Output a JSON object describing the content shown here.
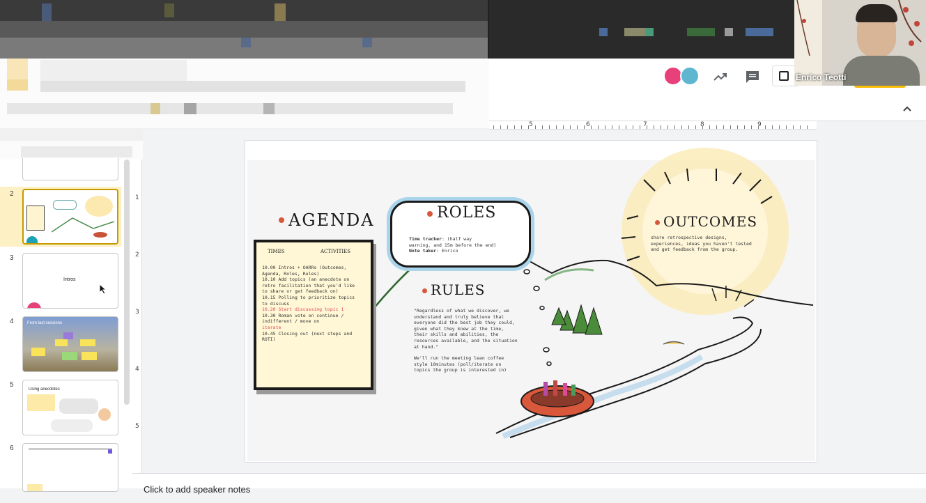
{
  "app": {
    "participant_name": "Enrico Teotti"
  },
  "toolbar": {
    "collapse_icon": "chevron-up-icon",
    "trend_icon": "trending-up-icon",
    "comment_icon": "comment-icon",
    "present_icon": "present-icon"
  },
  "ruler": {
    "labels": [
      "5",
      "6",
      "7",
      "8",
      "9"
    ]
  },
  "vruler": {
    "labels": [
      "1",
      "2",
      "3",
      "4",
      "5"
    ]
  },
  "filmstrip": {
    "slides": [
      {
        "num": "2",
        "selected": true
      },
      {
        "num": "3",
        "title": "Intros"
      },
      {
        "num": "4",
        "title": "From last sessions"
      },
      {
        "num": "5",
        "title": "Using anecdotes"
      },
      {
        "num": "6"
      }
    ]
  },
  "slide": {
    "agenda": {
      "title": "AGENDA",
      "col_times": "TIMES",
      "col_activities": "ACTIVITIES",
      "lines": [
        "10.00 Intros + OARRs (Outcomes,",
        "Agenda, Roles, Rules)",
        "10.10 Add topics (an anecdote on",
        "retro facilitation that you'd like",
        "to share or get feedback on)",
        "10.15 Polling to prioritize topics",
        "to discuss"
      ],
      "highlight_lines": [
        "10.20 Start discussing topic 1"
      ],
      "lines_after": [
        "10.30 Roman vote on continue /",
        "indifferent / move on"
      ],
      "iterate": "iterate",
      "closing_lines": [
        "10.45 Closing out (next steps and",
        "ROTI)"
      ]
    },
    "roles": {
      "title": "ROLES",
      "time_tracker_label": "Time tracker",
      "time_tracker_value": ": (half way",
      "time_tracker_line2": "warning, and 15m before the end)",
      "note_taker_label": "Note taker",
      "note_taker_value": ": Enrico"
    },
    "rules": {
      "title": "RULES",
      "lines": [
        "\"Regardless of what we discover, we",
        "understand and truly believe that",
        "everyone did the best job they could,",
        "given what they knew at the time,",
        "their skills and abilities, the",
        "resources available, and the situation",
        "at hand.\""
      ],
      "lines2": [
        "We'll run the meeting lean coffee",
        "style 10minutes (poll/iterate on",
        "topics the group is interested in)"
      ]
    },
    "outcomes": {
      "title": "OUTCOMES",
      "lines": [
        "share retrospective designs,",
        "experiences, ideas you haven't tested",
        "and get feedback from the group."
      ]
    }
  },
  "notes": {
    "placeholder": "Click to add speaker notes"
  }
}
